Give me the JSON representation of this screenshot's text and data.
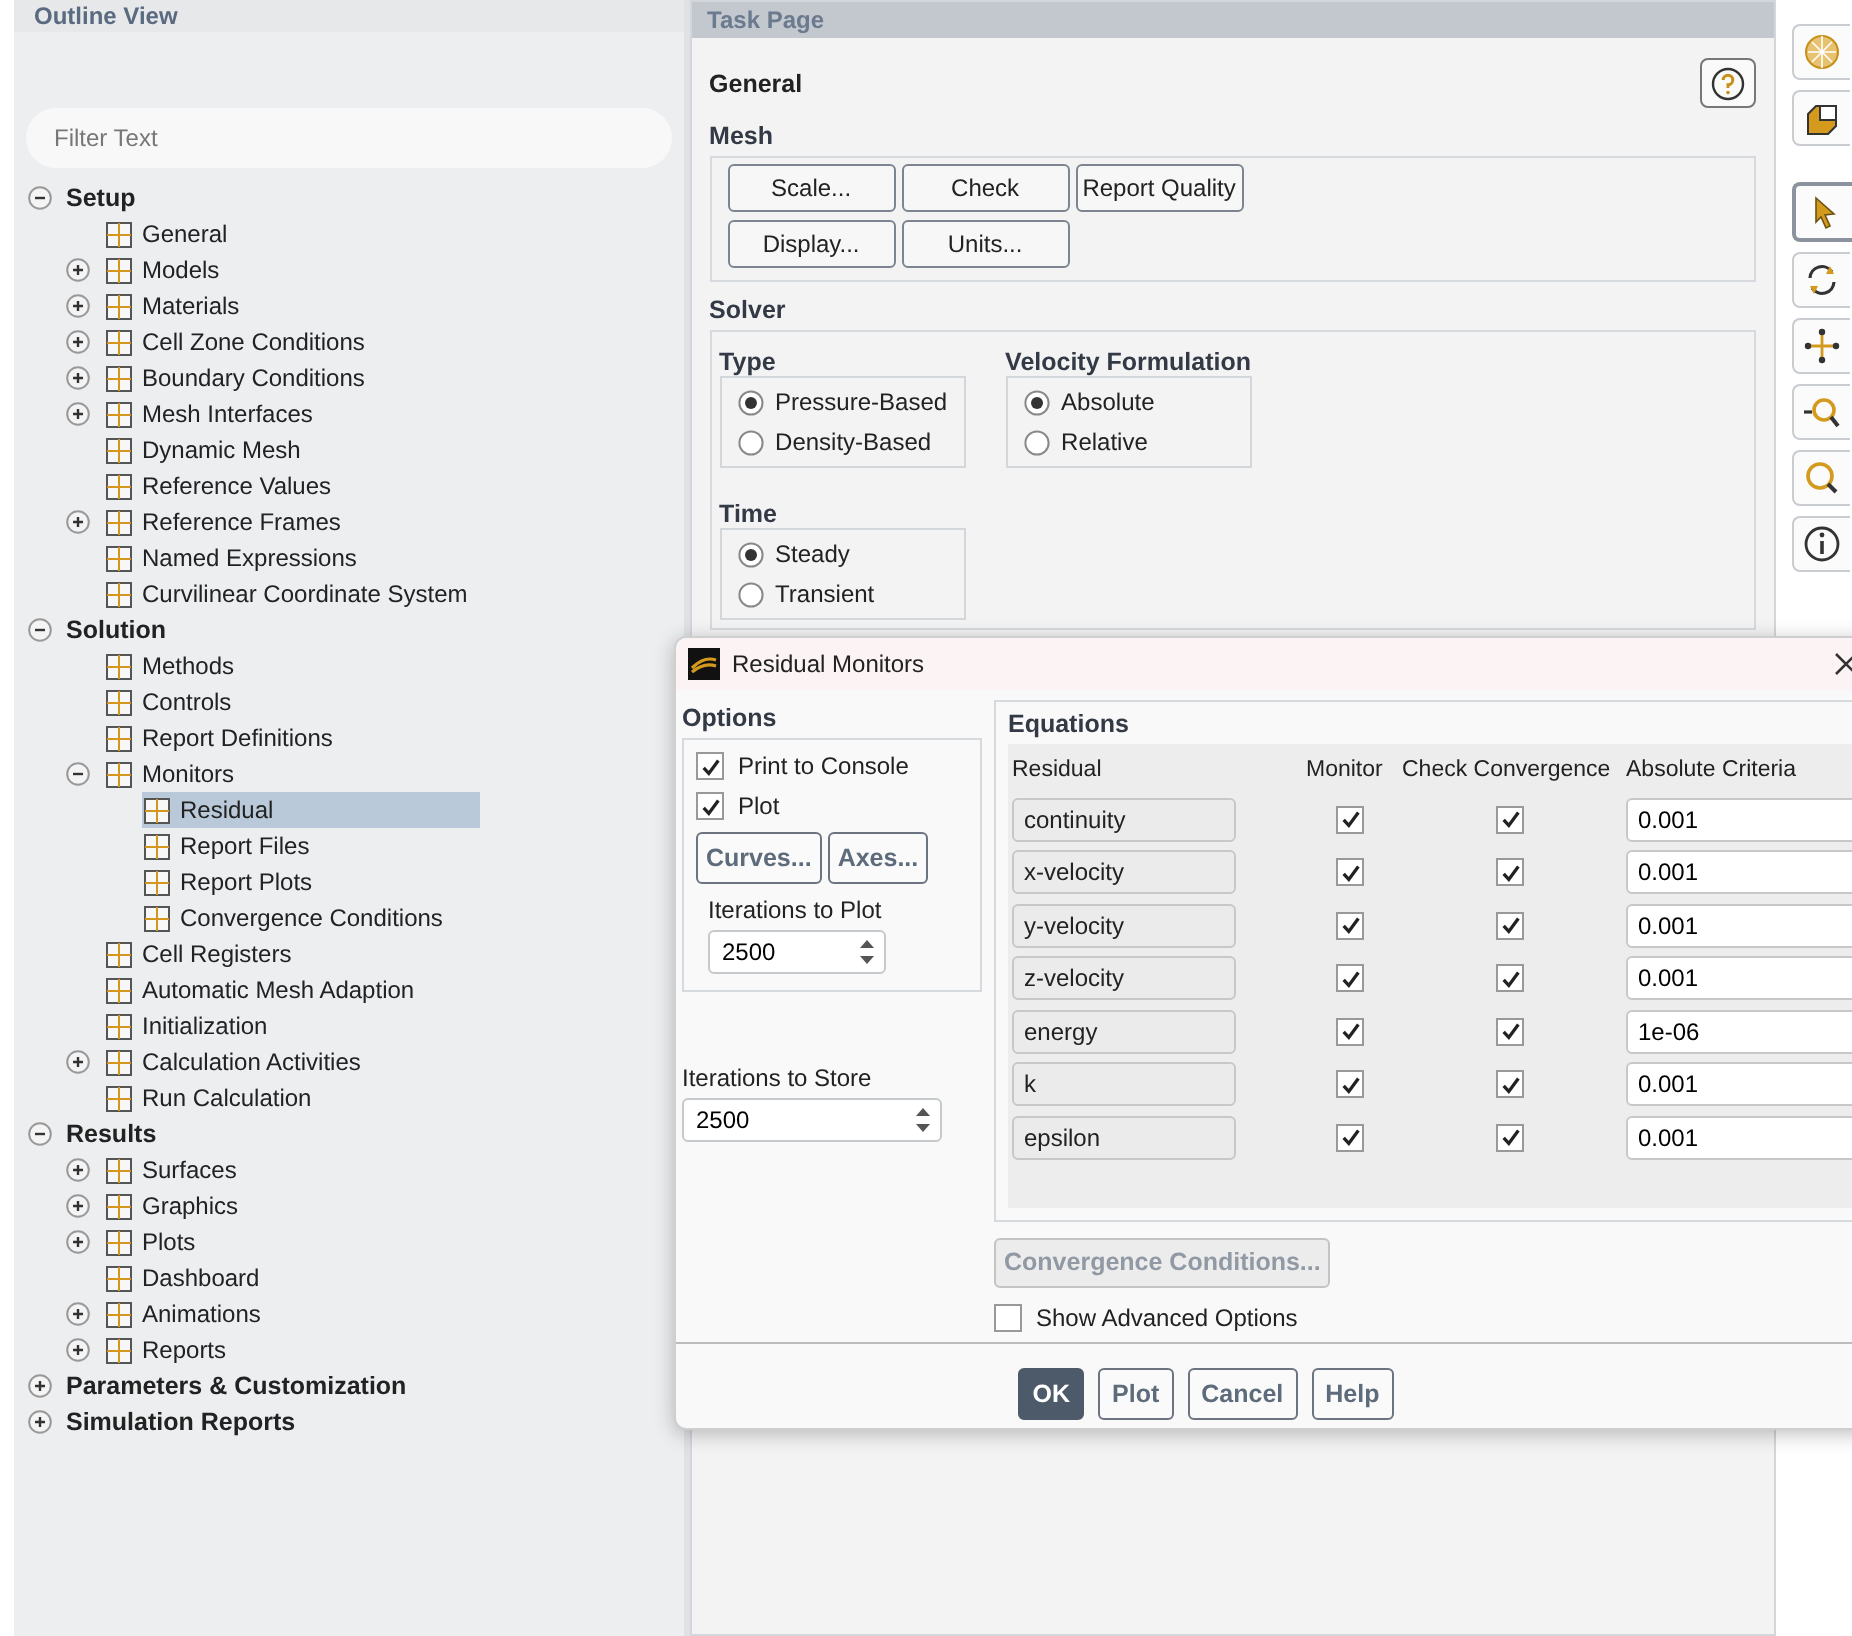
{
  "outline_view": {
    "title": "Outline View",
    "filter": {
      "placeholder": "Filter Text"
    },
    "tree": [
      {
        "label": "Setup",
        "expanded": true,
        "selected": false,
        "children": [
          {
            "label": "General",
            "selected": false
          },
          {
            "label": "Models",
            "expanded": false,
            "selected": false
          },
          {
            "label": "Materials",
            "expanded": false,
            "selected": false
          },
          {
            "label": "Cell Zone Conditions",
            "expanded": false,
            "selected": false
          },
          {
            "label": "Boundary Conditions",
            "expanded": false,
            "selected": false
          },
          {
            "label": "Mesh Interfaces",
            "expanded": false,
            "selected": false
          },
          {
            "label": "Dynamic Mesh",
            "selected": false
          },
          {
            "label": "Reference Values",
            "selected": false
          },
          {
            "label": "Reference Frames",
            "expanded": false,
            "selected": false
          },
          {
            "label": "Named Expressions",
            "selected": false
          },
          {
            "label": "Curvilinear Coordinate System",
            "selected": false
          }
        ]
      },
      {
        "label": "Solution",
        "expanded": true,
        "selected": false,
        "children": [
          {
            "label": "Methods",
            "selected": false
          },
          {
            "label": "Controls",
            "selected": false
          },
          {
            "label": "Report Definitions",
            "selected": false
          },
          {
            "label": "Monitors",
            "expanded": true,
            "selected": false,
            "children": [
              {
                "label": "Residual",
                "selected": true
              },
              {
                "label": "Report Files",
                "selected": false
              },
              {
                "label": "Report Plots",
                "selected": false
              },
              {
                "label": "Convergence Conditions",
                "selected": false
              }
            ]
          },
          {
            "label": "Cell Registers",
            "selected": false
          },
          {
            "label": "Automatic Mesh Adaption",
            "selected": false
          },
          {
            "label": "Initialization",
            "selected": false
          },
          {
            "label": "Calculation Activities",
            "expanded": false,
            "selected": false
          },
          {
            "label": "Run Calculation",
            "selected": false
          }
        ]
      },
      {
        "label": "Results",
        "expanded": true,
        "selected": false,
        "children": [
          {
            "label": "Surfaces",
            "expanded": false,
            "selected": false
          },
          {
            "label": "Graphics",
            "expanded": false,
            "selected": false
          },
          {
            "label": "Plots",
            "expanded": false,
            "selected": false
          },
          {
            "label": "Dashboard",
            "selected": false
          },
          {
            "label": "Animations",
            "expanded": false,
            "selected": false
          },
          {
            "label": "Reports",
            "expanded": false,
            "selected": false
          }
        ]
      },
      {
        "label": "Parameters & Customization",
        "expanded": false,
        "selected": false
      },
      {
        "label": "Simulation Reports",
        "expanded": false,
        "selected": false
      }
    ]
  },
  "task_page": {
    "title": "Task Page",
    "heading": "General",
    "mesh": {
      "label": "Mesh",
      "buttons": [
        "Scale...",
        "Check",
        "Report Quality",
        "Display...",
        "Units..."
      ]
    },
    "solver": {
      "label": "Solver",
      "type": {
        "label": "Type",
        "options": [
          {
            "label": "Pressure-Based",
            "selected": true
          },
          {
            "label": "Density-Based",
            "selected": false
          }
        ]
      },
      "velocity_formulation": {
        "label": "Velocity Formulation",
        "options": [
          {
            "label": "Absolute",
            "selected": true
          },
          {
            "label": "Relative",
            "selected": false
          }
        ]
      },
      "time": {
        "label": "Time",
        "options": [
          {
            "label": "Steady",
            "selected": true
          },
          {
            "label": "Transient",
            "selected": false
          }
        ]
      }
    }
  },
  "residual_dialog": {
    "title": "Residual Monitors",
    "options": {
      "label": "Options",
      "checkboxes": [
        {
          "label": "Print to Console",
          "checked": true
        },
        {
          "label": "Plot",
          "checked": true
        }
      ],
      "buttons": [
        "Curves...",
        "Axes..."
      ],
      "iterations_to_plot": {
        "label": "Iterations to Plot",
        "value": "2500"
      }
    },
    "iterations_to_store": {
      "label": "Iterations to Store",
      "value": "2500"
    },
    "equations": {
      "label": "Equations",
      "columns": [
        "Residual",
        "Monitor",
        "Check Convergence",
        "Absolute Criteria"
      ],
      "rows": [
        {
          "residual": "continuity",
          "monitor": true,
          "check_convergence": true,
          "criteria": "0.001"
        },
        {
          "residual": "x-velocity",
          "monitor": true,
          "check_convergence": true,
          "criteria": "0.001"
        },
        {
          "residual": "y-velocity",
          "monitor": true,
          "check_convergence": true,
          "criteria": "0.001"
        },
        {
          "residual": "z-velocity",
          "monitor": true,
          "check_convergence": true,
          "criteria": "0.001"
        },
        {
          "residual": "energy",
          "monitor": true,
          "check_convergence": true,
          "criteria": "1e-06"
        },
        {
          "residual": "k",
          "monitor": true,
          "check_convergence": true,
          "criteria": "0.001"
        },
        {
          "residual": "epsilon",
          "monitor": true,
          "check_convergence": true,
          "criteria": "0.001"
        }
      ]
    },
    "convergence_button": {
      "label": "Convergence Conditions...",
      "disabled": true
    },
    "show_advanced": {
      "label": "Show Advanced Options",
      "checked": false
    },
    "buttons": [
      {
        "label": "OK",
        "default": true
      },
      {
        "label": "Plot",
        "default": false
      },
      {
        "label": "Cancel",
        "default": false
      },
      {
        "label": "Help",
        "default": false
      }
    ]
  }
}
